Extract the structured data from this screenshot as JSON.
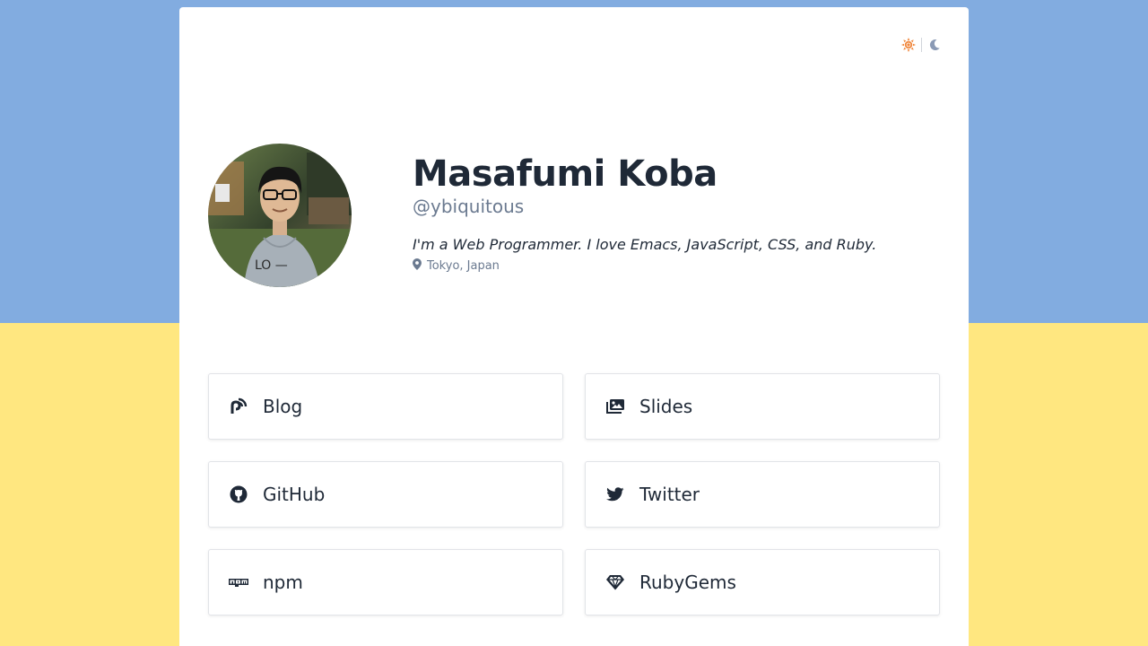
{
  "theme": {
    "light_icon": "sun-icon",
    "dark_icon": "moon-icon",
    "light_color": "#f0883e",
    "dark_color": "#8a9ab5"
  },
  "colors": {
    "top_background": "#82ace0",
    "bottom_background": "#ffe780"
  },
  "profile": {
    "avatar_alt": "avatar photo",
    "name": "Masafumi Koba",
    "handle": "@ybiquitous",
    "bio": "I'm a Web Programmer. I love Emacs, JavaScript, CSS, and Ruby.",
    "location": "Tokyo, Japan",
    "location_icon": "map-pin-icon"
  },
  "links": [
    {
      "label": "Blog",
      "icon": "blog-icon"
    },
    {
      "label": "Slides",
      "icon": "slides-icon"
    },
    {
      "label": "GitHub",
      "icon": "github-icon"
    },
    {
      "label": "Twitter",
      "icon": "twitter-icon"
    },
    {
      "label": "npm",
      "icon": "npm-icon"
    },
    {
      "label": "RubyGems",
      "icon": "rubygems-icon"
    }
  ]
}
